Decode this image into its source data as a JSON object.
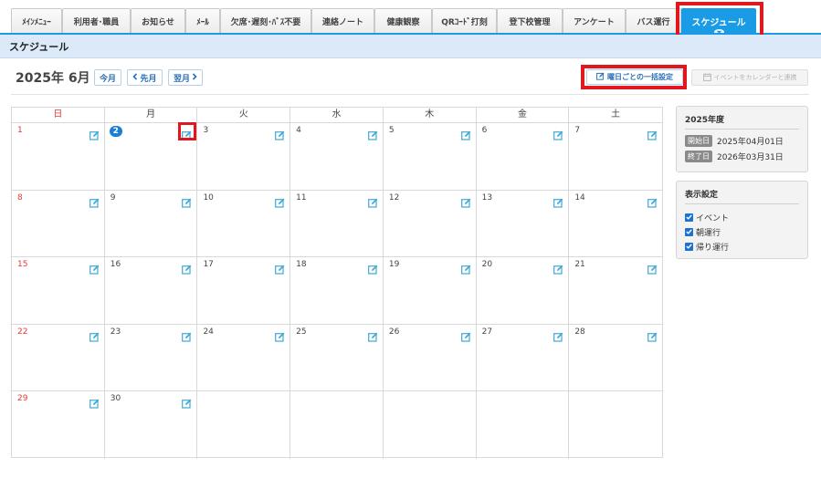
{
  "tabs": [
    {
      "label": "ﾒｲﾝﾒﾆｭｰ"
    },
    {
      "label": "利用者･職員"
    },
    {
      "label": "お知らせ"
    },
    {
      "label": "ﾒｰﾙ"
    },
    {
      "label": "欠席･遅刻･ﾊﾞｽ不要"
    },
    {
      "label": "連絡ノート"
    },
    {
      "label": "健康観察"
    },
    {
      "label": "QRｺｰﾄﾞ打刻"
    },
    {
      "label": "登下校管理"
    },
    {
      "label": "アンケート"
    },
    {
      "label": "バス運行"
    },
    {
      "label": "スケジュール",
      "active": true
    }
  ],
  "page_title": "スケジュール",
  "header": {
    "month_title": "2025年 6月",
    "today_label": "今月",
    "prev_label": "先月",
    "next_label": "翌月",
    "bulk_label": "曜日ごとの一括設定",
    "sync_label": "イベントをカレンダーと連携"
  },
  "calendar": {
    "weekdays": [
      "日",
      "月",
      "火",
      "水",
      "木",
      "金",
      "土"
    ],
    "today": 2,
    "weeks": [
      [
        1,
        2,
        3,
        4,
        5,
        6,
        7
      ],
      [
        8,
        9,
        10,
        11,
        12,
        13,
        14
      ],
      [
        15,
        16,
        17,
        18,
        19,
        20,
        21
      ],
      [
        22,
        23,
        24,
        25,
        26,
        27,
        28
      ],
      [
        29,
        30,
        null,
        null,
        null,
        null,
        null
      ]
    ]
  },
  "fiscal_year": {
    "title": "2025年度",
    "start_tag": "開始日",
    "start_date": "2025年04月01日",
    "end_tag": "終了日",
    "end_date": "2026年03月31日"
  },
  "display_settings": {
    "title": "表示設定",
    "options": [
      {
        "label": "イベント",
        "checked": true
      },
      {
        "label": "朝運行",
        "checked": true
      },
      {
        "label": "帰り運行",
        "checked": true
      }
    ]
  },
  "colors": {
    "accent": "#1a9be6",
    "highlight": "#e0181d",
    "sunday": "#e53935"
  }
}
